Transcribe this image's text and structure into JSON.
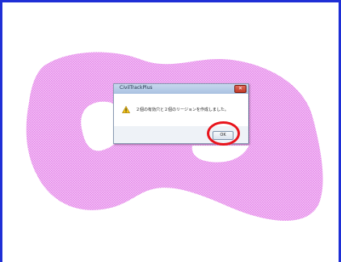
{
  "colors": {
    "frame_border": "#1f2fd6",
    "region_fill": "#ee9af2",
    "highlight": "#e8141c"
  },
  "dialog": {
    "title": "CivilTrackPlus",
    "message": "２個の有効穴と２個のリージョンを作成しました。",
    "ok_label": "OK",
    "close_icon": "close-icon",
    "message_icon": "warning-icon"
  }
}
